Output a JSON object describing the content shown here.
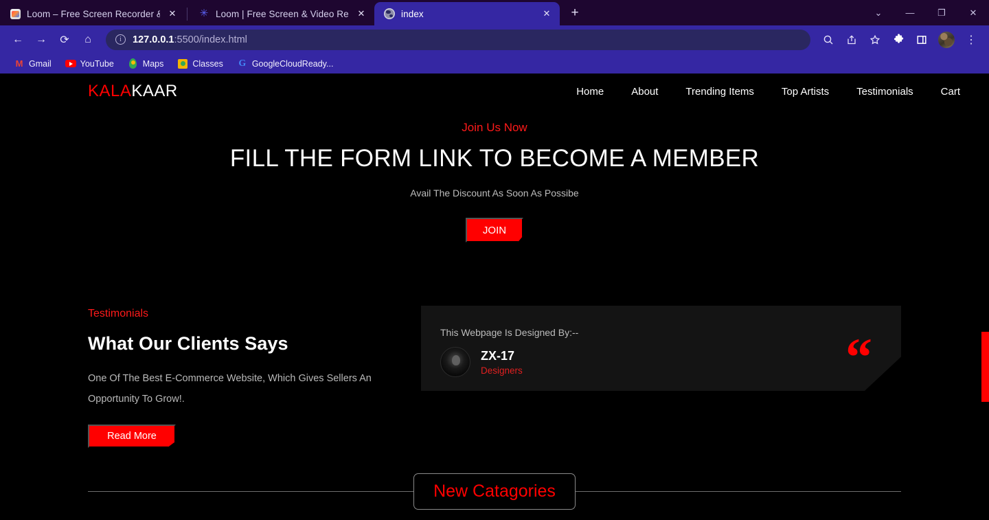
{
  "browser": {
    "tabs": [
      {
        "title": "Loom – Free Screen Recorder & S",
        "favicon": "loom-red-icon",
        "active": false,
        "close_label": "✕"
      },
      {
        "title": "Loom | Free Screen & Video Reco",
        "favicon": "loom-blue-icon",
        "active": false,
        "close_label": "✕"
      },
      {
        "title": "index",
        "favicon": "globe-icon",
        "active": true,
        "close_label": "✕"
      }
    ],
    "new_tab_label": "+",
    "window_controls": {
      "minimize_group": "⌄",
      "minimize": "—",
      "maximize": "❐",
      "close": "✕"
    },
    "toolbar": {
      "back": "←",
      "forward": "→",
      "reload": "⟳",
      "home": "⌂",
      "url_bold": "127.0.0.1",
      "url_rest": ":5500/index.html",
      "zoom_icon_label": "🔍",
      "share_icon_label": "↗",
      "bookmark_icon_label": "☆",
      "extensions_icon_label": "🧩",
      "sidepanel_icon_label": "▯",
      "menu_icon_label": "⋮"
    },
    "bookmarks": [
      {
        "label": "Gmail",
        "icon": "gmail-icon"
      },
      {
        "label": "YouTube",
        "icon": "youtube-icon"
      },
      {
        "label": "Maps",
        "icon": "maps-icon"
      },
      {
        "label": "Classes",
        "icon": "classroom-icon"
      },
      {
        "label": "GoogleCloudReady...",
        "icon": "google-icon"
      }
    ]
  },
  "site": {
    "logo": {
      "first": "KALA",
      "second": "KAAR"
    },
    "nav": [
      {
        "label": "Home"
      },
      {
        "label": "About"
      },
      {
        "label": "Trending Items"
      },
      {
        "label": "Top Artists"
      },
      {
        "label": "Testimonials"
      },
      {
        "label": "Cart"
      }
    ],
    "hero": {
      "kicker": "Join Us Now",
      "title": "FILL THE FORM LINK TO BECOME A MEMBER",
      "subtitle": "Avail The Discount As Soon As Possibe",
      "cta_label": "JOIN"
    },
    "testimonials": {
      "kicker": "Testimonials",
      "title": "What Our Clients Says",
      "body": "One Of The Best E-Commerce Website, Which Gives Sellers An Opportunity To Grow!.",
      "cta_label": "Read More",
      "card": {
        "label": "This Webpage Is Designed By:--",
        "name": "ZX-17",
        "role": "Designers",
        "quote_glyph": "“"
      }
    },
    "categories": {
      "heading": "New Catagories"
    },
    "colors": {
      "accent_red": "#ff0000",
      "page_bg": "#000000",
      "card_bg": "#141414",
      "chrome_indigo": "#3527a3",
      "omnibox_navy": "#2a2760",
      "tabstrip_purple": "#1e0630"
    }
  }
}
